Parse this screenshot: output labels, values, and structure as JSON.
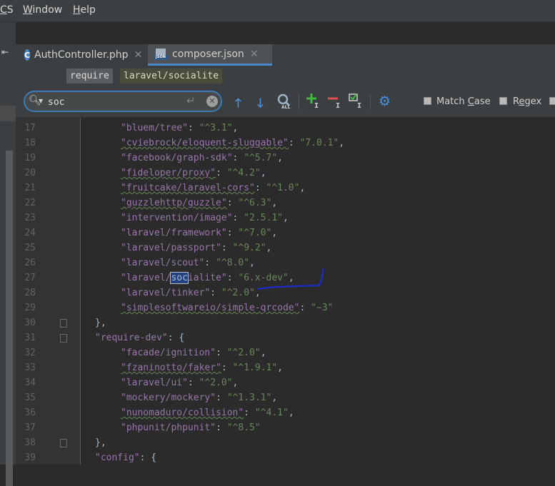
{
  "menubar": {
    "items": [
      {
        "mnemonic": "C",
        "rest": "S"
      },
      {
        "mnemonic": "W",
        "rest": "indow"
      },
      {
        "mnemonic": "H",
        "rest": "elp"
      }
    ]
  },
  "tabs": [
    {
      "label": "AuthController.php",
      "icon": "php-class-icon",
      "active": false
    },
    {
      "label": "composer.json",
      "icon": "json-file-icon",
      "active": true
    }
  ],
  "breadcrumb": [
    "require",
    "laravel/socialite"
  ],
  "search": {
    "value": "soc",
    "match_case_label": "Match Case",
    "match_case_mnemonic": "C",
    "regex_label": "Regex",
    "regex_mnemonic": "e"
  },
  "editor": {
    "lines": [
      {
        "num": "17",
        "indent": 2,
        "key": "\"bluem/tree\"",
        "wavy": false,
        "value": "\"^3.1\"",
        "tail": ","
      },
      {
        "num": "18",
        "indent": 2,
        "key": "\"cviebrock/eloquent-sluggable\"",
        "wavy": true,
        "value": "\"7.0.1\"",
        "tail": ","
      },
      {
        "num": "19",
        "indent": 2,
        "key": "\"facebook/graph-sdk\"",
        "wavy": false,
        "value": "\"^5.7\"",
        "tail": ","
      },
      {
        "num": "20",
        "indent": 2,
        "key": "\"fideloper/proxy\"",
        "wavy": true,
        "value": "\"^4.2\"",
        "tail": ","
      },
      {
        "num": "21",
        "indent": 2,
        "key": "\"fruitcake/laravel-cors\"",
        "wavy": true,
        "value": "\"^1.0\"",
        "tail": ","
      },
      {
        "num": "22",
        "indent": 2,
        "key": "\"guzzlehttp/guzzle\"",
        "wavy": true,
        "value": "\"^6.3\"",
        "tail": ","
      },
      {
        "num": "23",
        "indent": 2,
        "key": "\"intervention/image\"",
        "wavy": false,
        "value": "\"2.5.1\"",
        "tail": ","
      },
      {
        "num": "24",
        "indent": 2,
        "key": "\"laravel/framework\"",
        "wavy": false,
        "value": "\"^7.0\"",
        "tail": ","
      },
      {
        "num": "25",
        "indent": 2,
        "key": "\"laravel/passport\"",
        "wavy": false,
        "value": "\"^9.2\"",
        "tail": ","
      },
      {
        "num": "26",
        "indent": 2,
        "key": "\"laravel/scout\"",
        "wavy": false,
        "value": "\"^8.0\"",
        "tail": ","
      },
      {
        "num": "27",
        "indent": 2,
        "key_pre": "\"laravel/",
        "key_match": "soc",
        "key_post": "ialite\"",
        "wavy": false,
        "value": "\"6.x-dev\"",
        "tail": ","
      },
      {
        "num": "28",
        "indent": 2,
        "key": "\"laravel/tinker\"",
        "wavy": false,
        "value": "\"^2.0\"",
        "tail": ","
      },
      {
        "num": "29",
        "indent": 2,
        "key": "\"simplesoftwareio/simple-qrcode\"",
        "wavy": true,
        "value": "\"~3\"",
        "tail": ""
      },
      {
        "num": "30",
        "indent": 1,
        "punct": "},"
      },
      {
        "num": "31",
        "indent": 1,
        "key": "\"require-dev\"",
        "wavy": false,
        "punct_after": ": {"
      },
      {
        "num": "32",
        "indent": 2,
        "key": "\"facade/ignition\"",
        "wavy": false,
        "value": "\"^2.0\"",
        "tail": ","
      },
      {
        "num": "33",
        "indent": 2,
        "key": "\"fzaninotto/faker\"",
        "wavy": true,
        "value": "\"^1.9.1\"",
        "tail": ","
      },
      {
        "num": "34",
        "indent": 2,
        "key": "\"laravel/ui\"",
        "wavy": false,
        "value": "\"^2.0\"",
        "tail": ","
      },
      {
        "num": "35",
        "indent": 2,
        "key": "\"mockery/mockery\"",
        "wavy": false,
        "value": "\"^1.3.1\"",
        "tail": ","
      },
      {
        "num": "36",
        "indent": 2,
        "key": "\"nunomaduro/collision\"",
        "wavy": true,
        "value": "\"^4.1\"",
        "tail": ","
      },
      {
        "num": "37",
        "indent": 2,
        "key": "\"phpunit/phpunit\"",
        "wavy": false,
        "value": "\"^8.5\"",
        "tail": ""
      },
      {
        "num": "38",
        "indent": 1,
        "punct": "},"
      },
      {
        "num": "39",
        "indent": 1,
        "key": "\"config\"",
        "wavy": false,
        "punct_after": ": {"
      }
    ]
  },
  "colors": {
    "key": "#9876aa",
    "string": "#6a8759",
    "match_bg": "#214283",
    "annotation": "#1a2bd8"
  }
}
